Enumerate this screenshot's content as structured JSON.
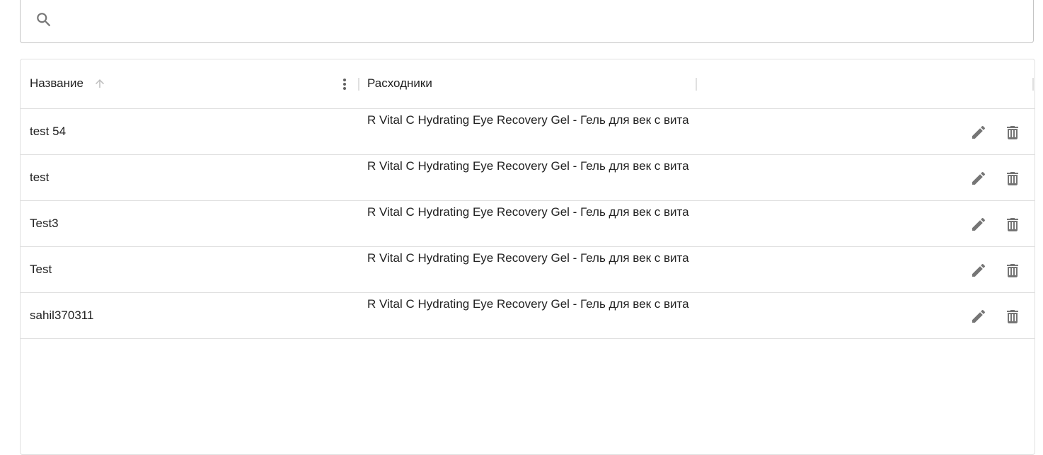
{
  "search": {
    "value": "",
    "icon": "search-icon"
  },
  "table": {
    "columns": [
      {
        "label": "Название",
        "sort": "ascending"
      },
      {
        "label": "Расходники"
      },
      {
        "label": ""
      }
    ],
    "rows": [
      {
        "name": "test 54",
        "supplies": "R Vital C Hydrating Eye Recovery Gel - Гель для век с вита"
      },
      {
        "name": "test",
        "supplies": "R Vital C Hydrating Eye Recovery Gel - Гель для век с вита"
      },
      {
        "name": "Test3",
        "supplies": "R Vital C Hydrating Eye Recovery Gel - Гель для век с вита"
      },
      {
        "name": "Test",
        "supplies": "R Vital C Hydrating Eye Recovery Gel - Гель для век с вита"
      },
      {
        "name": "sahil370311",
        "supplies": "R Vital C Hydrating Eye Recovery Gel - Гель для век с вита"
      }
    ],
    "row_actions": [
      "edit-icon",
      "delete-icon"
    ]
  },
  "colors": {
    "border": "#e0e0e0",
    "icon": "#757575",
    "text": "#212121"
  }
}
